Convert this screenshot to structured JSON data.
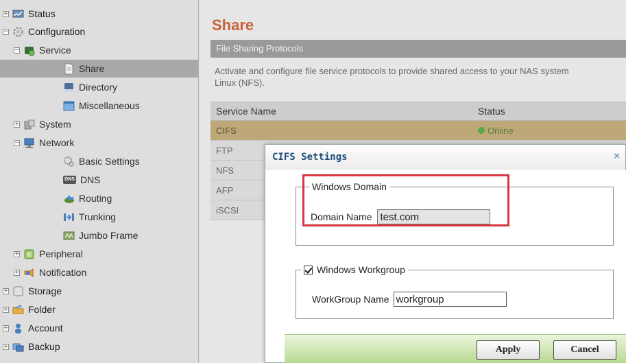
{
  "sidebar": {
    "items": [
      {
        "label": "Status",
        "toggle": "+",
        "icon": "status-icon"
      },
      {
        "label": "Configuration",
        "toggle": "−",
        "icon": "configuration-icon"
      },
      {
        "label": "Service",
        "toggle": "−",
        "icon": "service-icon"
      },
      {
        "label": "Share",
        "toggle": "",
        "icon": "share-icon"
      },
      {
        "label": "Directory",
        "toggle": "",
        "icon": "directory-icon"
      },
      {
        "label": "Miscellaneous",
        "toggle": "",
        "icon": "miscellaneous-icon"
      },
      {
        "label": "System",
        "toggle": "+",
        "icon": "system-icon"
      },
      {
        "label": "Network",
        "toggle": "−",
        "icon": "network-icon"
      },
      {
        "label": "Basic Settings",
        "toggle": "",
        "icon": "basic-settings-icon"
      },
      {
        "label": "DNS",
        "toggle": "",
        "icon": "dns-icon",
        "icon_text": "DNS"
      },
      {
        "label": "Routing",
        "toggle": "",
        "icon": "routing-icon"
      },
      {
        "label": "Trunking",
        "toggle": "",
        "icon": "trunking-icon"
      },
      {
        "label": "Jumbo Frame",
        "toggle": "",
        "icon": "jumbo-frame-icon"
      },
      {
        "label": "Peripheral",
        "toggle": "+",
        "icon": "peripheral-icon"
      },
      {
        "label": "Notification",
        "toggle": "+",
        "icon": "notification-icon"
      },
      {
        "label": "Storage",
        "toggle": "+",
        "icon": "storage-icon"
      },
      {
        "label": "Folder",
        "toggle": "+",
        "icon": "folder-icon"
      },
      {
        "label": "Account",
        "toggle": "+",
        "icon": "account-icon"
      },
      {
        "label": "Backup",
        "toggle": "+",
        "icon": "backup-icon"
      }
    ]
  },
  "main": {
    "title": "Share",
    "section_title": "File Sharing Protocols",
    "description_line1": "Activate and configure file service protocols to provide shared access to your NAS system",
    "description_line2": "Linux (NFS).",
    "table": {
      "headers": [
        "Service Name",
        "Status"
      ],
      "rows": [
        {
          "name": "CIFS",
          "status": "Online"
        },
        {
          "name": "FTP",
          "status": ""
        },
        {
          "name": "NFS",
          "status": ""
        },
        {
          "name": "AFP",
          "status": ""
        },
        {
          "name": "iSCSI",
          "status": ""
        }
      ]
    }
  },
  "dialog": {
    "title": "CIFS Settings",
    "close_glyph": "×",
    "domain_group": {
      "legend": "Windows Domain",
      "domain_name_label": "Domain Name",
      "domain_name_value": "test.com"
    },
    "workgroup_group": {
      "legend": "Windows Workgroup",
      "checked": true,
      "workgroup_name_label": "WorkGroup Name",
      "workgroup_name_value": "workgroup"
    },
    "apply_label": "Apply",
    "cancel_label": "Cancel"
  },
  "colors": {
    "title_accent": "#c8633a",
    "selected_row": "#bfa878",
    "highlight_border": "#d8343c",
    "online": "#5aa84a",
    "dialog_title": "#1f4d7a"
  }
}
